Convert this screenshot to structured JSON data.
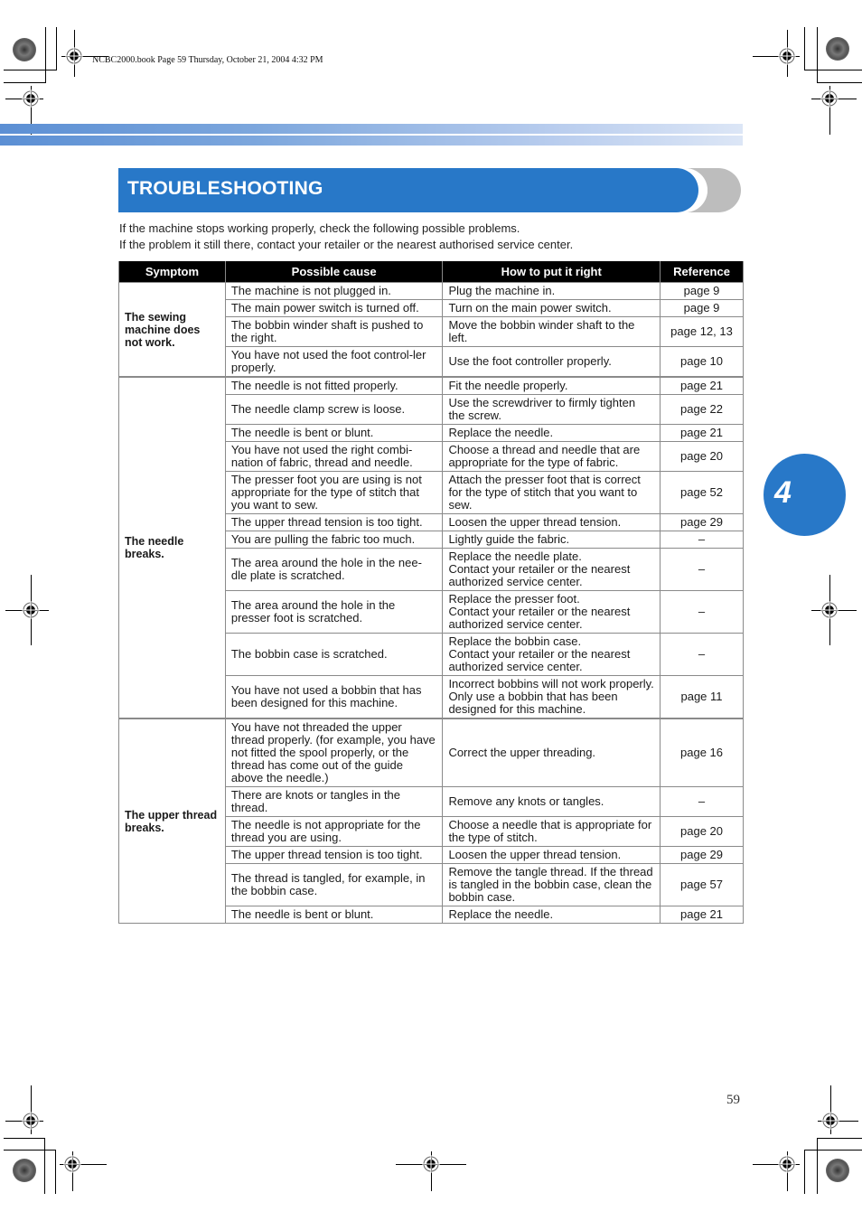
{
  "print_header": "NCBC2000.book  Page 59  Thursday, October 21, 2004  4:32 PM",
  "title": "TROUBLESHOOTING",
  "intro": [
    "If the machine stops working properly, check the following possible problems.",
    "If the problem it still there, contact your retailer or the nearest authorised service center."
  ],
  "table": {
    "headers": [
      "Symptom",
      "Possible cause",
      "How to put it right",
      "Reference"
    ],
    "groups": [
      {
        "symptom": "The sewing machine does not work.",
        "rows": [
          {
            "cause": "The machine is not plugged in.",
            "fix": "Plug the machine in.",
            "ref": "page 9"
          },
          {
            "cause": "The main power switch is turned off.",
            "fix": "Turn on the main power switch.",
            "ref": "page 9"
          },
          {
            "cause": "The bobbin winder shaft is pushed to the right.",
            "fix": "Move the bobbin winder shaft to the left.",
            "ref": "page 12, 13"
          },
          {
            "cause": "You have not used the foot control-ler properly.",
            "fix": "Use the foot controller properly.",
            "ref": "page 10"
          }
        ]
      },
      {
        "symptom": "The needle breaks.",
        "rows": [
          {
            "cause": "The needle is not fitted properly.",
            "fix": "Fit the needle properly.",
            "ref": "page 21"
          },
          {
            "cause": "The needle clamp screw is loose.",
            "fix": "Use the screwdriver to firmly tighten the screw.",
            "ref": "page 22"
          },
          {
            "cause": "The needle is bent or blunt.",
            "fix": "Replace the needle.",
            "ref": "page 21"
          },
          {
            "cause": "You have not used the right combi-nation of fabric, thread and needle.",
            "fix": "Choose a thread and needle that are appropriate for the type of fabric.",
            "ref": "page 20"
          },
          {
            "cause": "The presser foot you are using is not appropriate for the type of stitch that you want to sew.",
            "fix": "Attach the presser foot that is correct for the type of stitch that you want to sew.",
            "ref": "page 52"
          },
          {
            "cause": "The upper thread tension is too tight.",
            "fix": "Loosen the upper thread tension.",
            "ref": "page 29"
          },
          {
            "cause": "You are pulling the fabric too much.",
            "fix": "Lightly guide the fabric.",
            "ref": "–"
          },
          {
            "cause": "The area around the hole in the nee-dle plate is scratched.",
            "fix": "Replace the needle plate.\nContact your retailer or the nearest authorized service center.",
            "ref": "–"
          },
          {
            "cause": "The area around the hole in the presser foot is scratched.",
            "fix": "Replace the presser foot.\nContact your retailer or the nearest authorized service center.",
            "ref": "–"
          },
          {
            "cause": "The bobbin case is scratched.",
            "fix": "Replace the bobbin case.\nContact your retailer or the nearest authorized service center.",
            "ref": "–"
          },
          {
            "cause": "You have not used a bobbin that has been designed for this machine.",
            "fix": "Incorrect bobbins will not work properly. Only use a bobbin that has been designed for this machine.",
            "ref": "page 11"
          }
        ]
      },
      {
        "symptom": "The upper thread breaks.",
        "rows": [
          {
            "cause": "You have not threaded the upper thread properly. (for example, you have not fitted the spool properly, or the thread has come out of the guide above the needle.)",
            "fix": "Correct the upper threading.",
            "ref": "page 16"
          },
          {
            "cause": "There are knots or tangles in the thread.",
            "fix": "Remove any knots or tangles.",
            "ref": "–"
          },
          {
            "cause": "The needle is not appropriate for the thread you are using.",
            "fix": "Choose a needle that is appropriate for the type of stitch.",
            "ref": "page 20"
          },
          {
            "cause": "The upper thread tension is too tight.",
            "fix": "Loosen the upper thread tension.",
            "ref": "page 29"
          },
          {
            "cause": "The thread is tangled, for example, in the bobbin case.",
            "fix": "Remove the tangle thread. If the thread is tangled in the bobbin case, clean the bobbin case.",
            "ref": "page 57"
          },
          {
            "cause": "The needle is bent or blunt.",
            "fix": "Replace the needle.",
            "ref": "page 21"
          }
        ]
      }
    ]
  },
  "chapter_number": "4",
  "page_number": "59",
  "colors": {
    "accent_blue": "#2878c8",
    "header_black": "#000000",
    "cap_gray": "#bdbdbd"
  }
}
